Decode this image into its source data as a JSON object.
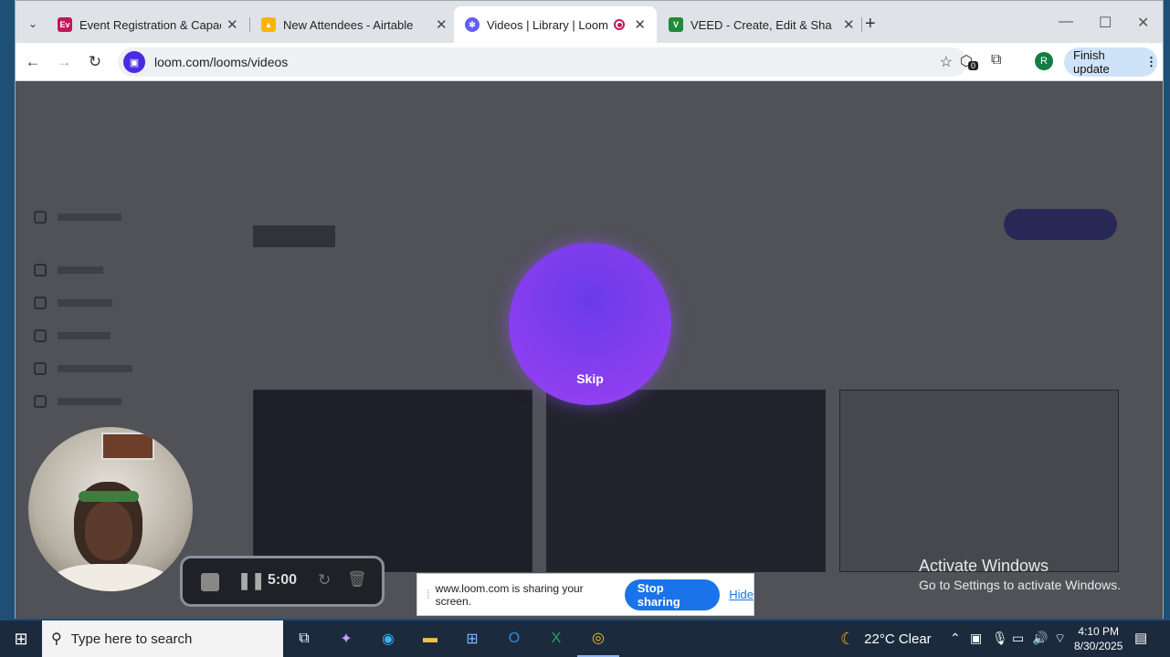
{
  "browser": {
    "tabs": [
      {
        "title": "Event Registration & Capacity M",
        "icon": "ev-icon",
        "icon_text": "Ev",
        "color": "#c2185b"
      },
      {
        "title": "New Attendees - Airtable",
        "icon": "airtable-icon",
        "color": "#fcb400"
      },
      {
        "title": "Videos | Library | Loom",
        "icon": "loom-icon",
        "color": "#625df5",
        "active": true
      },
      {
        "title": "VEED - Create, Edit & Share Vid",
        "icon": "veed-icon",
        "icon_text": "V",
        "color": "#1f8a3a"
      }
    ],
    "url": "loom.com/looms/videos",
    "avatar_letter": "R",
    "finish_update_label": "Finish update",
    "extension_badge": "0"
  },
  "recording": {
    "skip_label": "Skip",
    "timer": "5:00"
  },
  "sharing": {
    "message": "www.loom.com is sharing your screen.",
    "stop_label": "Stop sharing",
    "hide_label": "Hide"
  },
  "watermark": {
    "line1": "Activate Windows",
    "line2": "Go to Settings to activate Windows."
  },
  "taskbar": {
    "search_placeholder": "Type here to search",
    "weather": "22°C Clear",
    "time": "4:10 PM",
    "date": "8/30/2025"
  }
}
